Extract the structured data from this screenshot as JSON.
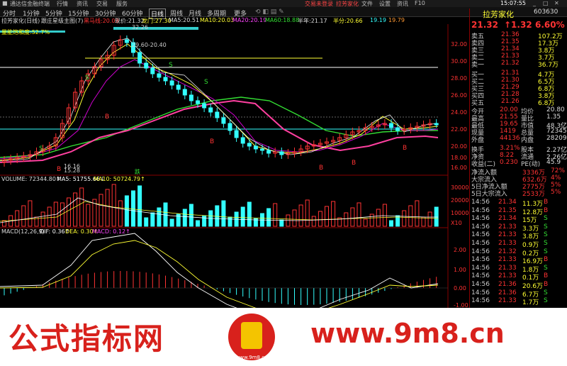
{
  "app": {
    "title": "通达信金融终端",
    "left_tabs": [
      "行情",
      "资讯",
      "交易",
      "服务"
    ],
    "center_warn": "交易未登录",
    "stock_center": "拉芳家化",
    "time": "15:07:55",
    "right_items": [
      "文件",
      "设置",
      "资讯",
      "F10"
    ]
  },
  "menu": {
    "periods": [
      "分时",
      "1分钟",
      "5分钟",
      "15分钟",
      "30分钟",
      "60分钟",
      "日线",
      "周线",
      "月线",
      "多周期",
      "更多"
    ],
    "active": "日线"
  },
  "indicator_bar": {
    "stock": "拉芳家化(日线)",
    "formula": "跟庄星级主图(7)",
    "line1": "黑马线:20.09",
    "line2": "现价:21.32",
    "line3": "龙门:27.30",
    "ma5": "MA5:20.51",
    "ma10": "MA10:20.03",
    "ma20": "MA20:20.19",
    "ma60": "MA60:18.88",
    "extra": "半年:21.17",
    "half": "半分:20.66",
    "v1": "19.19",
    "v2": "19.79"
  },
  "chart_labels": {
    "sat": "量能饱和度:52.7%",
    "high": "32.26",
    "mid": "29.60-20.40",
    "low": "16.16",
    "low2": "15.28",
    "dragon": "龙门",
    "xq": "跌"
  },
  "y_axis": [
    "32.00",
    "30.00",
    "28.00",
    "26.00",
    "24.00",
    "22.00",
    "20.00",
    "18.00",
    "16.00"
  ],
  "vol": {
    "title": "VOLUME: 72344.80↑",
    "ma5": "MA5: 51755.66↓",
    "ma10": "MA10: 50724.79↑",
    "axis": [
      "30000",
      "20000",
      "10000",
      "X10"
    ]
  },
  "macd": {
    "title": "MACD(12,26,9)",
    "dif": "DIF: 0.36↑",
    "dea": "DEA: 0.30↑",
    "macd": "MACD: 0.12↑",
    "axis": [
      "2.00",
      "1.00",
      "0.00",
      "-1.00"
    ]
  },
  "quote": {
    "name": "拉芳家化",
    "code": "603630",
    "price": "21.32",
    "change": "↑1.32",
    "pct": "6.60%",
    "sell": [
      {
        "l": "卖五",
        "p": "21.36",
        "v": "107.2万"
      },
      {
        "l": "卖四",
        "p": "21.35",
        "v": "17.3万"
      },
      {
        "l": "卖三",
        "p": "21.34",
        "v": "3.8万"
      },
      {
        "l": "卖二",
        "p": "21.33",
        "v": "3.7万"
      },
      {
        "l": "卖一",
        "p": "21.32",
        "v": "36.7万"
      }
    ],
    "buy": [
      {
        "l": "买一",
        "p": "21.31",
        "v": "4.7万"
      },
      {
        "l": "买二",
        "p": "21.30",
        "v": "6.5万"
      },
      {
        "l": "买三",
        "p": "21.29",
        "v": "6.8万"
      },
      {
        "l": "买四",
        "p": "21.28",
        "v": "3.8万"
      },
      {
        "l": "买五",
        "p": "21.26",
        "v": "6.8万"
      }
    ],
    "info": [
      [
        "今开",
        "20.00",
        "均价",
        "20.80"
      ],
      [
        "最高",
        "21.55",
        "量比",
        "1.35"
      ],
      [
        "最低",
        "19.65",
        "市值",
        "48.3亿"
      ],
      [
        "现量",
        "1419",
        "总量",
        "72345"
      ],
      [
        "外盘",
        "44136",
        "内盘",
        "28209"
      ],
      [
        "换手",
        "3.21%",
        "股本",
        "2.27亿"
      ],
      [
        "净资",
        "8.22",
        "流通",
        "2.26亿"
      ],
      [
        "收益(二)",
        "0.230",
        "PE(动)",
        "45.9"
      ]
    ],
    "flow": [
      [
        "净流入额",
        "3336万",
        "72%"
      ],
      [
        "大宗流入",
        "632.6万",
        "4%"
      ],
      [
        "5日净流入额",
        "2775万",
        "5%"
      ],
      [
        "5日大宗流入",
        "2533万",
        "5%"
      ]
    ],
    "ticks": [
      [
        "14:56",
        "21.34",
        "11.3万",
        "B"
      ],
      [
        "14:56",
        "21.35",
        "12.8万",
        "B"
      ],
      [
        "14:56",
        "21.34",
        "15万",
        "S"
      ],
      [
        "14:56",
        "21.33",
        "3.3万",
        "S"
      ],
      [
        "14:56",
        "21.33",
        "3.8万",
        "S"
      ],
      [
        "14:56",
        "21.33",
        "0.9万",
        "S"
      ],
      [
        "14:56",
        "21.32",
        "0.2万",
        "S"
      ],
      [
        "14:56",
        "21.33",
        "16.9万",
        "B"
      ],
      [
        "14:56",
        "21.33",
        "1.8万",
        "S"
      ],
      [
        "14:56",
        "21.33",
        "0.1万",
        "B"
      ],
      [
        "14:56",
        "21.36",
        "20.6万",
        "B"
      ],
      [
        "14:56",
        "21.36",
        "6.7万",
        "S"
      ],
      [
        "14:56",
        "21.33",
        "1.7万",
        "S"
      ]
    ]
  },
  "watermark": {
    "left": "公式指标网",
    "right": "www.9m8.cn",
    "seal": "www.9m8.cn"
  }
}
